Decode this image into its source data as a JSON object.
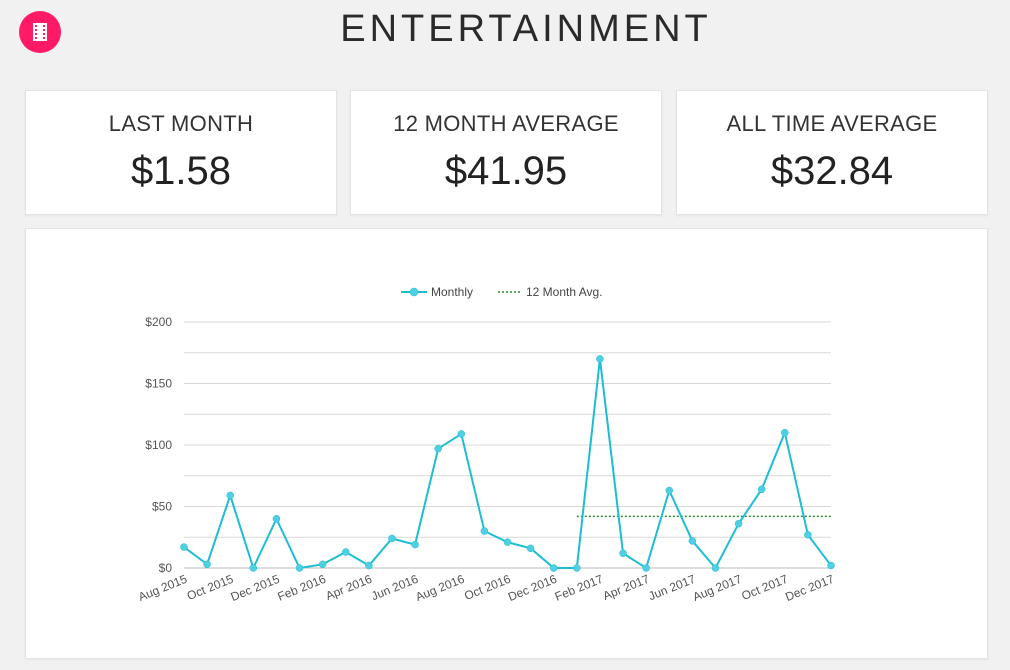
{
  "header": {
    "title": "ENTERTAINMENT",
    "category_icon": "film-icon",
    "badge_color": "#ff1a68"
  },
  "stats": [
    {
      "label": "LAST MONTH",
      "value": "$1.58"
    },
    {
      "label": "12 MONTH AVERAGE",
      "value": "$41.95"
    },
    {
      "label": "ALL TIME AVERAGE",
      "value": "$32.84"
    }
  ],
  "chart_data": {
    "type": "line",
    "title": "",
    "xlabel": "",
    "ylabel": "",
    "ylim": [
      0,
      200
    ],
    "y_ticks": [
      "$0",
      "$50",
      "$100",
      "$150",
      "$200"
    ],
    "grid": true,
    "legend_position": "top-center",
    "x": [
      "Aug 2015",
      "Sep 2015",
      "Oct 2015",
      "Nov 2015",
      "Dec 2015",
      "Jan 2016",
      "Feb 2016",
      "Mar 2016",
      "Apr 2016",
      "May 2016",
      "Jun 2016",
      "Jul 2016",
      "Aug 2016",
      "Sep 2016",
      "Oct 2016",
      "Nov 2016",
      "Dec 2016",
      "Jan 2017",
      "Feb 2017",
      "Mar 2017",
      "Apr 2017",
      "May 2017",
      "Jun 2017",
      "Jul 2017",
      "Aug 2017",
      "Sep 2017",
      "Oct 2017",
      "Nov 2017",
      "Dec 2017"
    ],
    "x_tick_labels": [
      "Aug 2015",
      "Oct 2015",
      "Dec 2015",
      "Feb 2016",
      "Apr 2016",
      "Jun 2016",
      "Aug 2016",
      "Oct 2016",
      "Dec 2016",
      "Feb 2017",
      "Apr 2017",
      "Jun 2017",
      "Aug 2017",
      "Oct 2017",
      "Dec 2017"
    ],
    "series": [
      {
        "name": "Monthly",
        "color": "#1dbdd4",
        "values": [
          17,
          3,
          59,
          0,
          40,
          0,
          3,
          13,
          2,
          24,
          19,
          97,
          109,
          30,
          21,
          16,
          0,
          0,
          170,
          12,
          0,
          63,
          22,
          0,
          36,
          64,
          110,
          27,
          2
        ]
      },
      {
        "name": "12 Month Avg.",
        "color": "#2e8b2e",
        "style": "dotted",
        "x_start": "Jan 2017",
        "x_end": "Dec 2017",
        "value": 41.95
      }
    ]
  }
}
